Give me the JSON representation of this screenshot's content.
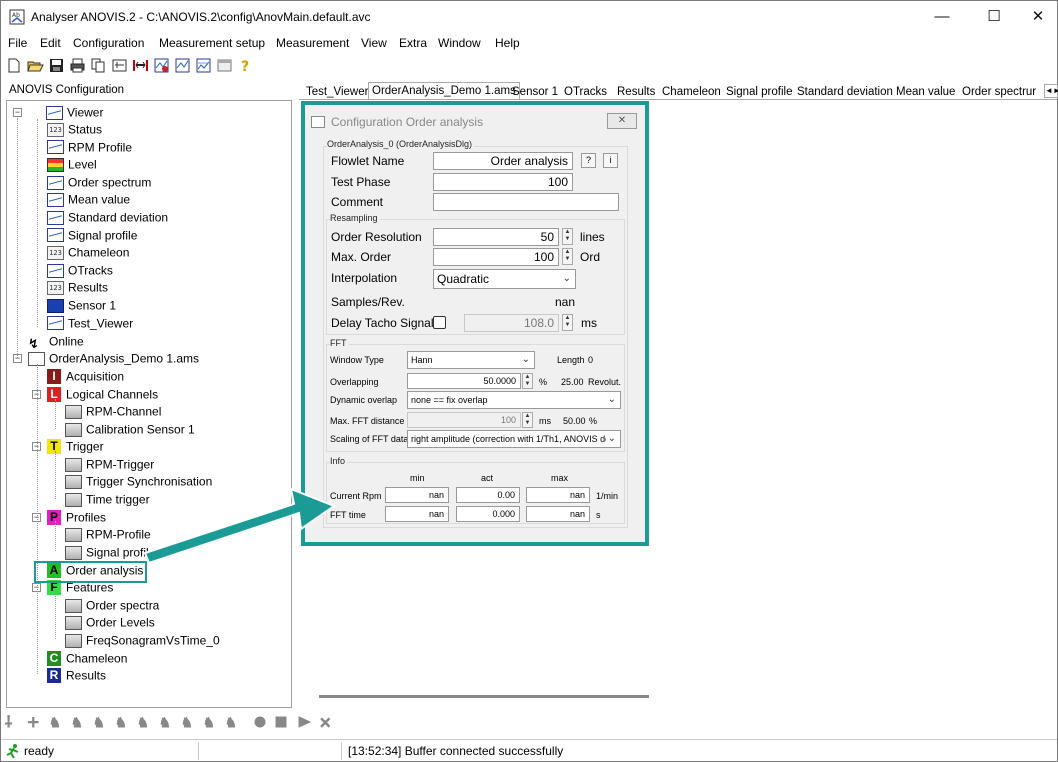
{
  "window": {
    "title": "Analyser ANOVIS.2 - C:\\ANOVIS.2\\config\\AnovMain.default.avc",
    "minimize": "—",
    "maximize": "☐",
    "close": "✕"
  },
  "menu": [
    "File",
    "Edit",
    "Configuration",
    "Measurement setup",
    "Measurement",
    "View",
    "Extra",
    "Window",
    "Help"
  ],
  "toolbar_icons": [
    "new-icon",
    "open-icon",
    "save-icon",
    "print-icon",
    "copy-icon",
    "settings-icon",
    "split-icon",
    "record-icon",
    "chart-icon",
    "chart2-icon",
    "window-icon",
    "help-icon"
  ],
  "left_panel": {
    "title": "ANOVIS Configuration",
    "tree": {
      "viewer": "Viewer",
      "viewer_items": [
        "Status",
        "RPM Profile",
        "Level",
        "Order spectrum",
        "Mean value",
        "Standard deviation",
        "Signal profile",
        "Chameleon",
        "OTracks",
        "Results",
        "Sensor 1",
        "Test_Viewer"
      ],
      "online": "Online",
      "project": "OrderAnalysis_Demo 1.ams",
      "acquisition": "Acquisition",
      "logical_channels": "Logical Channels",
      "lc_items": [
        "RPM-Channel",
        "Calibration Sensor 1"
      ],
      "trigger": "Trigger",
      "trigger_items": [
        "RPM-Trigger",
        "Trigger Synchronisation",
        "Time trigger"
      ],
      "profiles": "Profiles",
      "profile_items": [
        "RPM-Profile",
        "Signal profile"
      ],
      "order_analysis": "Order analysis",
      "features": "Features",
      "feature_items": [
        "Order spectra",
        "Order Levels",
        "FreqSonagramVsTime_0"
      ],
      "chameleon": "Chameleon",
      "results": "Results",
      "letters": {
        "acquisition": "I",
        "logical": "L",
        "trigger": "T",
        "profiles": "P",
        "order": "A",
        "features": "F",
        "chameleon": "C",
        "results": "R"
      }
    }
  },
  "tabs": [
    "Test_Viewer",
    "OrderAnalysis_Demo 1.ams",
    "Sensor 1",
    "OTracks",
    "Results",
    "Chameleon",
    "Signal profile",
    "Standard deviation",
    "Mean value",
    "Order spectrur"
  ],
  "tab_arrows": "◄►",
  "dialog": {
    "title": "Configuration Order analysis",
    "close": "✕",
    "group_main": "OrderAnalysis_0 (OrderAnalysisDlg)",
    "flowlet_name_label": "Flowlet Name",
    "flowlet_name_value": "Order analysis",
    "help_btn": "?",
    "info_btn": "i",
    "test_phase_label": "Test Phase",
    "test_phase_value": "100",
    "comment_label": "Comment",
    "comment_value": "",
    "resampling_group": "Resampling",
    "order_resolution_label": "Order Resolution",
    "order_resolution_value": "50",
    "order_resolution_unit": "lines",
    "max_order_label": "Max. Order",
    "max_order_value": "100",
    "max_order_unit": "Ord",
    "interpolation_label": "Interpolation",
    "interpolation_value": "Quadratic",
    "samples_label": "Samples/Rev.",
    "samples_value": "nan",
    "delay_label": "Delay Tacho Signal",
    "delay_value": "108.0",
    "delay_unit": "ms",
    "fft_group": "FFT",
    "window_type_label": "Window Type",
    "window_type_value": "Hann",
    "length_label": "Length",
    "length_value": "0",
    "overlapping_label": "Overlapping",
    "overlapping_value": "50.0000",
    "overlapping_unit": "%",
    "revolut_value": "25.00",
    "revolut_unit": "Revolut.",
    "dynamic_overlap_label": "Dynamic overlap",
    "dynamic_overlap_value": "none == fix overlap",
    "max_fft_label": "Max. FFT distance",
    "max_fft_value": "100",
    "max_fft_unit": "ms",
    "max_fft_pct": "50.00",
    "max_fft_pct_unit": "%",
    "scaling_label": "Scaling of FFT data",
    "scaling_value": "right amplitude (correction with 1/Th1, ANOVIS de",
    "info_group": "Info",
    "col_min": "min",
    "col_act": "act",
    "col_max": "max",
    "current_rpm_label": "Current Rpm",
    "current_rpm": [
      "nan",
      "0.00",
      "nan"
    ],
    "current_rpm_unit": "1/min",
    "fft_time_label": "FFT time",
    "fft_time": [
      "nan",
      "0.000",
      "nan"
    ],
    "fft_time_unit": "s"
  },
  "status": {
    "state": "ready",
    "message": "[13:52:34] Buffer connected successfully"
  },
  "colors": {
    "highlight": "#1a9b95",
    "letter_I": "#8b1a1a",
    "letter_L": "#e02020",
    "letter_T": "#f5e600",
    "letter_P": "#e020c0",
    "letter_A": "#20c020",
    "letter_F": "#30e040",
    "letter_C": "#209020",
    "letter_R": "#1a2a90"
  }
}
